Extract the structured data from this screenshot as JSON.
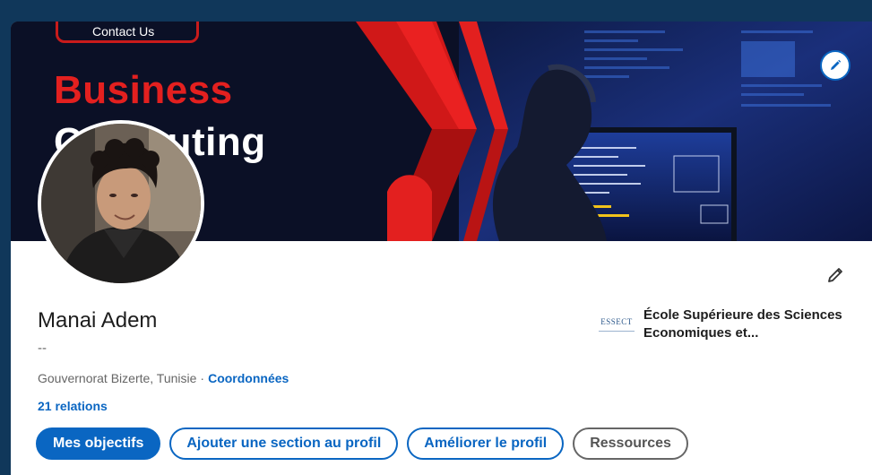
{
  "banner": {
    "contact_label": "Contact Us",
    "line1": "Business",
    "line2": "Computing"
  },
  "profile": {
    "name": "Manai Adem",
    "headline": "--",
    "location": "Gouvernorat Bizerte, Tunisie",
    "location_separator": "·",
    "contact_link": "Coordonnées",
    "relations": "21 relations"
  },
  "education": {
    "logo_text": "ESSECT",
    "school_name": "École Supérieure des Sciences Economiques et..."
  },
  "actions": {
    "primary": "Mes objectifs",
    "add_section": "Ajouter une section au profil",
    "improve": "Améliorer le profil",
    "resources": "Ressources"
  },
  "icons": {
    "edit_banner": "pencil-icon",
    "edit_intro": "pencil-icon"
  },
  "colors": {
    "accent": "#0a66c2",
    "frame": "#10375a",
    "banner_red": "#e3201f"
  }
}
